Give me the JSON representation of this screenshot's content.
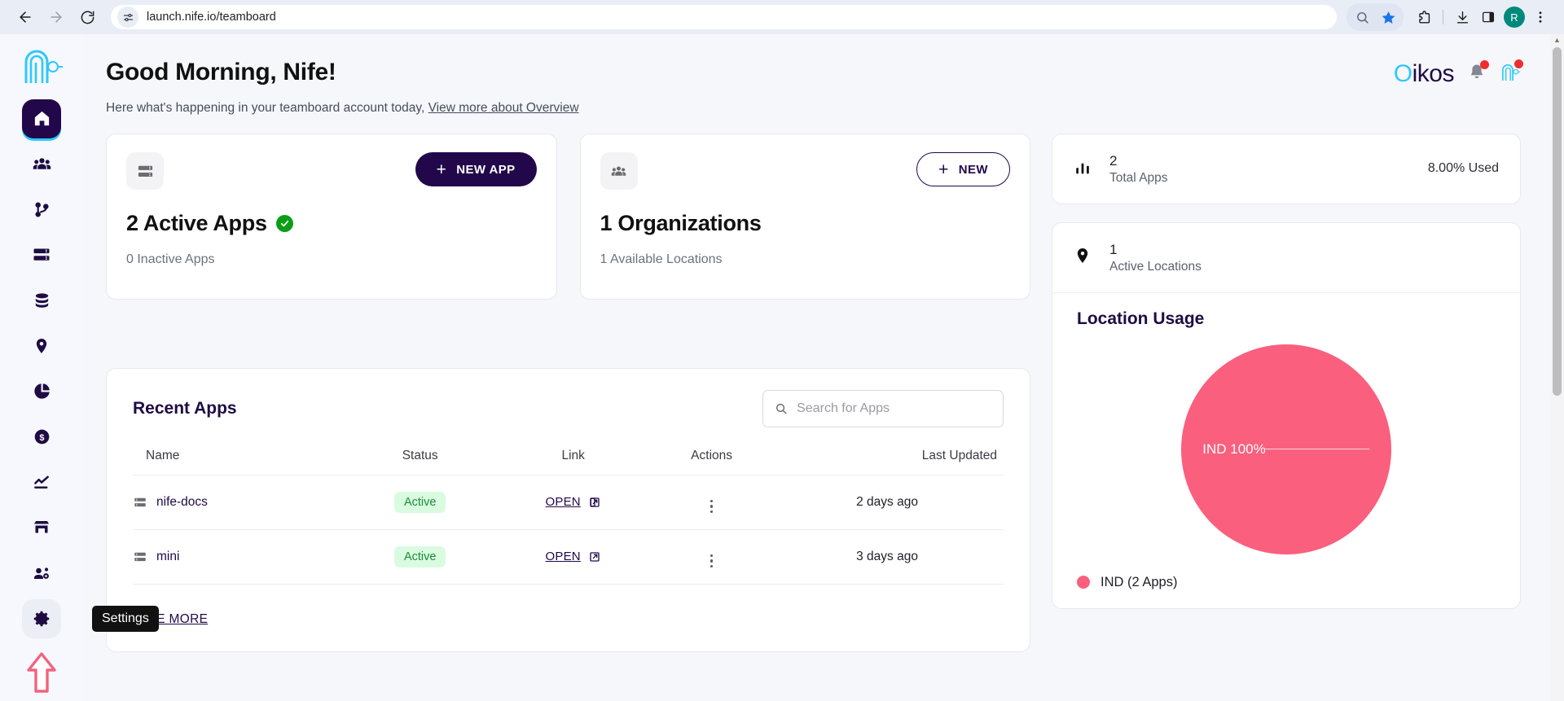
{
  "browser": {
    "url": "launch.nife.io/teamboard",
    "back_label": "Back",
    "forward_label": "Forward",
    "reload_label": "Reload",
    "site_info_label": "site-settings-icon",
    "zoom_label": "zoom-search-icon",
    "bookmark_label": "Bookmark this tab",
    "extensions_label": "Extensions",
    "downloads_label": "Downloads",
    "sidepanel_label": "Side panel",
    "profile_initial": "R",
    "menu_label": "Customize and control"
  },
  "sidebar": {
    "logo_name": "nife-logo",
    "items": [
      {
        "name": "home",
        "label": "Home",
        "active": true
      },
      {
        "name": "teams",
        "label": "Teams",
        "active": false
      },
      {
        "name": "pipelines",
        "label": "Pipelines",
        "active": false
      },
      {
        "name": "servers",
        "label": "Servers",
        "active": false
      },
      {
        "name": "databases",
        "label": "Databases",
        "active": false
      },
      {
        "name": "locations",
        "label": "Locations",
        "active": false
      },
      {
        "name": "analytics",
        "label": "Analytics",
        "active": false
      },
      {
        "name": "billing",
        "label": "Billing",
        "active": false
      },
      {
        "name": "metrics",
        "label": "Metrics",
        "active": false
      },
      {
        "name": "marketplace",
        "label": "Marketplace",
        "active": false
      },
      {
        "name": "user-management",
        "label": "User Management",
        "active": false
      },
      {
        "name": "settings",
        "label": "Settings",
        "active": false
      }
    ],
    "tooltip": "Settings",
    "upgrade_label": "Upgrade"
  },
  "header": {
    "greeting": "Good Morning, Nife!",
    "subline_text": "Here what's happening in your teamboard account today,",
    "subline_link": "View more about Overview",
    "brand_first": "O",
    "brand_rest": "ikos",
    "brand_accent": "#2ec8ff",
    "notification_dot_color": "#f02d2d"
  },
  "cards": {
    "apps": {
      "icon": "server-stack-icon",
      "button_label": "NEW APP",
      "title": "2 Active Apps",
      "status_icon": "check-circle-icon",
      "status_color": "#0a9e16",
      "subtitle": "0 Inactive Apps"
    },
    "orgs": {
      "icon": "people-group-icon",
      "button_label": "NEW",
      "title": "1 Organizations",
      "subtitle": "1 Available Locations"
    }
  },
  "recent_apps": {
    "title": "Recent Apps",
    "search_placeholder": "Search for Apps",
    "search_value": "",
    "columns": [
      "Name",
      "Status",
      "Link",
      "Actions",
      "Last Updated"
    ],
    "rows": [
      {
        "name": "nife-docs",
        "icon": "server-stack-icon",
        "status": "Active",
        "link_label": "OPEN",
        "link_icon": "external-link-icon",
        "actions_icon": "kebab-menu-icon",
        "last_updated": "2 days ago"
      },
      {
        "name": "mini",
        "icon": "server-stack-icon",
        "status": "Active",
        "link_label": "OPEN",
        "link_icon": "external-link-icon",
        "actions_icon": "kebab-menu-icon",
        "last_updated": "3 days ago"
      }
    ],
    "see_more_label": "SEE MORE"
  },
  "stats": {
    "total_apps": {
      "icon": "bar-chart-icon",
      "value": "2",
      "label": "Total Apps",
      "usage": "8.00% Used"
    },
    "active_locations": {
      "icon": "map-pin-icon",
      "value": "1",
      "label": "Active Locations"
    }
  },
  "chart_data": {
    "type": "pie",
    "title": "Location Usage",
    "categories": [
      "IND"
    ],
    "values": [
      100
    ],
    "labels": [
      "IND 100%"
    ],
    "legend": [
      "IND (2 Apps)"
    ],
    "colors": [
      "#fa5f7d"
    ],
    "legend_position": "bottom",
    "grid": false
  }
}
